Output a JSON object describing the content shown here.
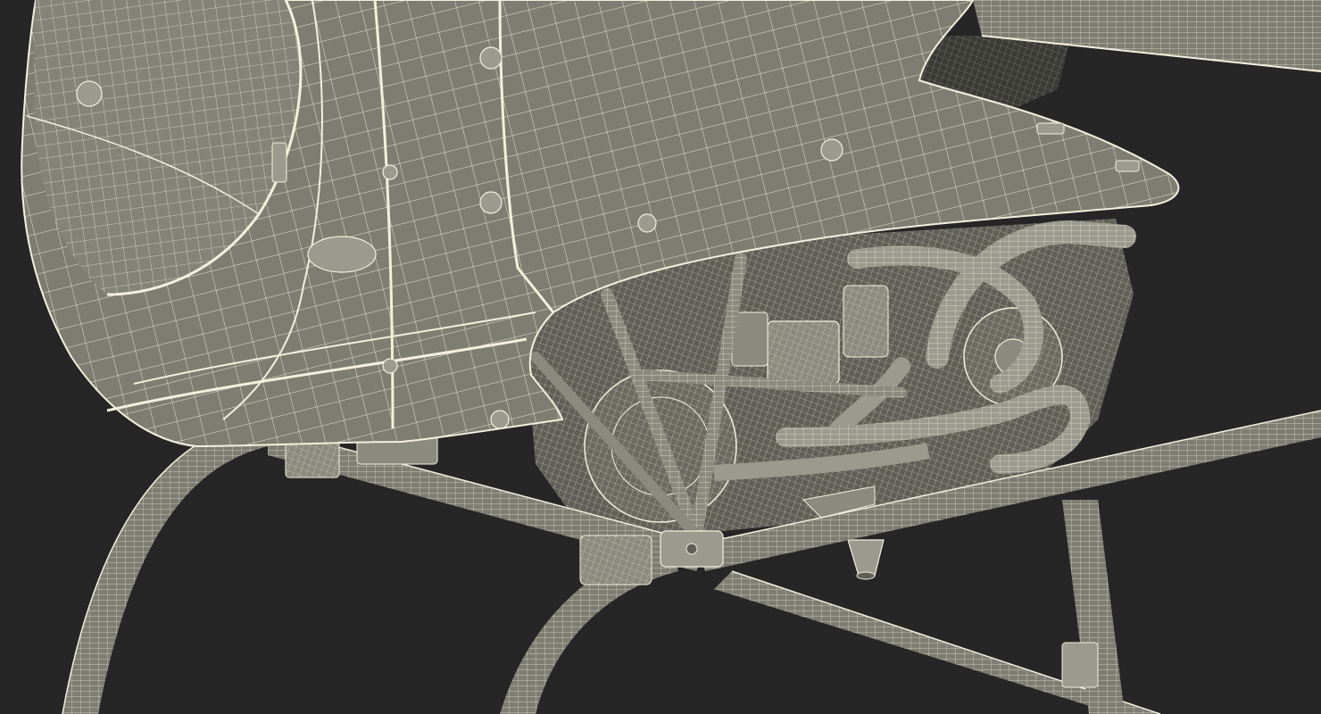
{
  "scene": {
    "subject": "helicopter-wireframe-render",
    "colors": {
      "background": "#262626",
      "surface": "#7d7d72",
      "surface_dark": "#5f5f57",
      "surface_light": "#9a9a8e",
      "wire": "#f2f0dc",
      "wire_dim": "#c9c7b3",
      "cavity": "#3a3a36"
    }
  }
}
